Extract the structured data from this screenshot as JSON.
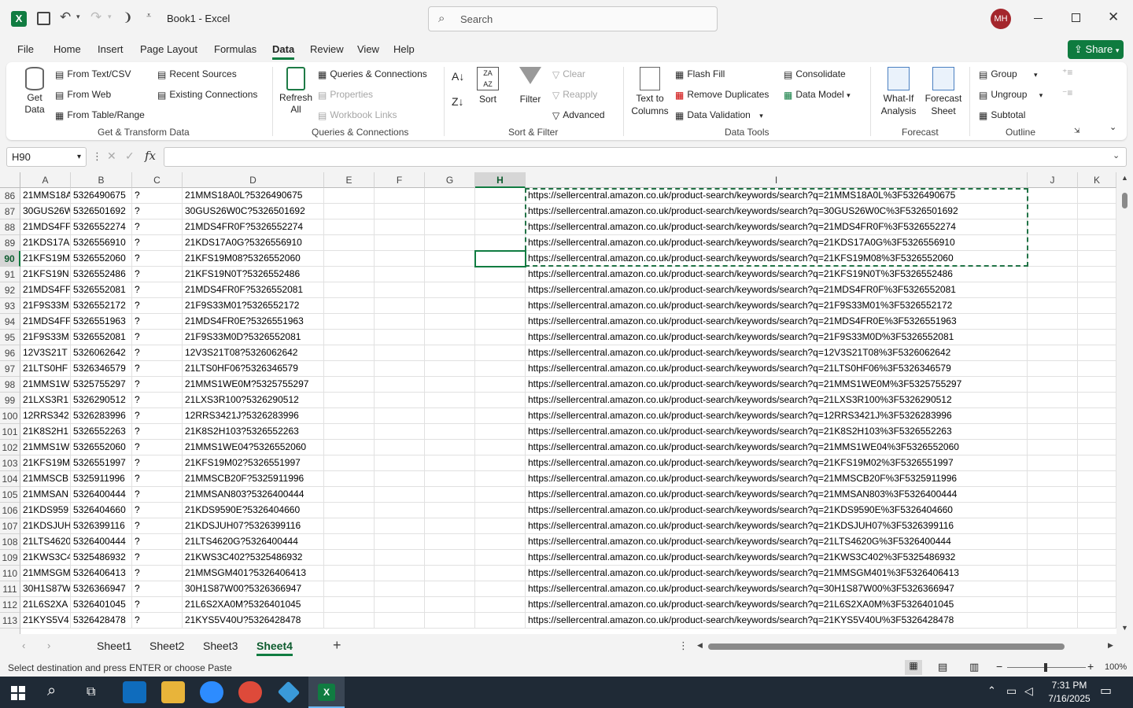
{
  "window": {
    "title": "Book1  -  Excel",
    "search_placeholder": "Search",
    "user_initials": "MH",
    "share_label": "Share"
  },
  "tabs": [
    "File",
    "Home",
    "Insert",
    "Page Layout",
    "Formulas",
    "Data",
    "Review",
    "View",
    "Help"
  ],
  "active_tab": "Data",
  "ribbon": {
    "get_data": "Get\nData",
    "from_text_csv": "From Text/CSV",
    "from_web": "From Web",
    "from_table_range": "From Table/Range",
    "recent_sources": "Recent Sources",
    "existing_connections": "Existing Connections",
    "group_get_transform": "Get & Transform Data",
    "refresh_all": "Refresh All",
    "queries_connections": "Queries & Connections",
    "properties": "Properties",
    "workbook_links": "Workbook Links",
    "group_queries": "Queries & Connections",
    "sort": "Sort",
    "filter": "Filter",
    "clear": "Clear",
    "reapply": "Reapply",
    "advanced": "Advanced",
    "group_sort_filter": "Sort & Filter",
    "text_to_columns": "Text to Columns",
    "flash_fill": "Flash Fill",
    "remove_duplicates": "Remove Duplicates",
    "data_validation": "Data Validation",
    "consolidate": "Consolidate",
    "data_model": "Data Model",
    "group_data_tools": "Data Tools",
    "what_if": "What-If Analysis",
    "forecast_sheet": "Forecast Sheet",
    "group_forecast": "Forecast",
    "group_btn": "Group",
    "ungroup": "Ungroup",
    "subtotal": "Subtotal",
    "group_outline": "Outline"
  },
  "namebox": "H90",
  "formula": "",
  "columns": [
    "A",
    "B",
    "C",
    "D",
    "E",
    "F",
    "G",
    "H",
    "I",
    "J",
    "K"
  ],
  "selected_column": "H",
  "selected_row": "90",
  "rows": [
    {
      "n": "86",
      "a": "21MMS18A",
      "b": "5326490675",
      "c": "?",
      "d": "21MMS18A0L?5326490675",
      "i": "https://sellercentral.amazon.co.uk/product-search/keywords/search?q=21MMS18A0L%3F5326490675"
    },
    {
      "n": "87",
      "a": "30GUS26W",
      "b": "5326501692",
      "c": "?",
      "d": "30GUS26W0C?5326501692",
      "i": "https://sellercentral.amazon.co.uk/product-search/keywords/search?q=30GUS26W0C%3F5326501692"
    },
    {
      "n": "88",
      "a": "21MDS4FF",
      "b": "5326552274",
      "c": "?",
      "d": "21MDS4FR0F?5326552274",
      "i": "https://sellercentral.amazon.co.uk/product-search/keywords/search?q=21MDS4FR0F%3F5326552274"
    },
    {
      "n": "89",
      "a": "21KDS17A",
      "b": "5326556910",
      "c": "?",
      "d": "21KDS17A0G?5326556910",
      "i": "https://sellercentral.amazon.co.uk/product-search/keywords/search?q=21KDS17A0G%3F5326556910"
    },
    {
      "n": "90",
      "a": "21KFS19M",
      "b": "5326552060",
      "c": "?",
      "d": "21KFS19M08?5326552060",
      "i": "https://sellercentral.amazon.co.uk/product-search/keywords/search?q=21KFS19M08%3F5326552060"
    },
    {
      "n": "91",
      "a": "21KFS19N",
      "b": "5326552486",
      "c": "?",
      "d": "21KFS19N0T?5326552486",
      "i": "https://sellercentral.amazon.co.uk/product-search/keywords/search?q=21KFS19N0T%3F5326552486"
    },
    {
      "n": "92",
      "a": "21MDS4FF",
      "b": "5326552081",
      "c": "?",
      "d": "21MDS4FR0F?5326552081",
      "i": "https://sellercentral.amazon.co.uk/product-search/keywords/search?q=21MDS4FR0F%3F5326552081"
    },
    {
      "n": "93",
      "a": "21F9S33M",
      "b": "5326552172",
      "c": "?",
      "d": "21F9S33M01?5326552172",
      "i": "https://sellercentral.amazon.co.uk/product-search/keywords/search?q=21F9S33M01%3F5326552172"
    },
    {
      "n": "94",
      "a": "21MDS4FF",
      "b": "5326551963",
      "c": "?",
      "d": "21MDS4FR0E?5326551963",
      "i": "https://sellercentral.amazon.co.uk/product-search/keywords/search?q=21MDS4FR0E%3F5326551963"
    },
    {
      "n": "95",
      "a": "21F9S33M",
      "b": "5326552081",
      "c": "?",
      "d": "21F9S33M0D?5326552081",
      "i": "https://sellercentral.amazon.co.uk/product-search/keywords/search?q=21F9S33M0D%3F5326552081"
    },
    {
      "n": "96",
      "a": "12V3S21T",
      "b": "5326062642",
      "c": "?",
      "d": "12V3S21T08?5326062642",
      "i": "https://sellercentral.amazon.co.uk/product-search/keywords/search?q=12V3S21T08%3F5326062642"
    },
    {
      "n": "97",
      "a": "21LTS0HF",
      "b": "5326346579",
      "c": "?",
      "d": "21LTS0HF06?5326346579",
      "i": "https://sellercentral.amazon.co.uk/product-search/keywords/search?q=21LTS0HF06%3F5326346579"
    },
    {
      "n": "98",
      "a": "21MMS1W",
      "b": "5325755297",
      "c": "?",
      "d": "21MMS1WE0M?5325755297",
      "i": "https://sellercentral.amazon.co.uk/product-search/keywords/search?q=21MMS1WE0M%3F5325755297"
    },
    {
      "n": "99",
      "a": "21LXS3R1",
      "b": "5326290512",
      "c": "?",
      "d": "21LXS3R100?5326290512",
      "i": "https://sellercentral.amazon.co.uk/product-search/keywords/search?q=21LXS3R100%3F5326290512"
    },
    {
      "n": "100",
      "a": "12RRS342",
      "b": "5326283996",
      "c": "?",
      "d": "12RRS3421J?5326283996",
      "i": "https://sellercentral.amazon.co.uk/product-search/keywords/search?q=12RRS3421J%3F5326283996"
    },
    {
      "n": "101",
      "a": "21K8S2H1",
      "b": "5326552263",
      "c": "?",
      "d": "21K8S2H103?5326552263",
      "i": "https://sellercentral.amazon.co.uk/product-search/keywords/search?q=21K8S2H103%3F5326552263"
    },
    {
      "n": "102",
      "a": "21MMS1W",
      "b": "5326552060",
      "c": "?",
      "d": "21MMS1WE04?5326552060",
      "i": "https://sellercentral.amazon.co.uk/product-search/keywords/search?q=21MMS1WE04%3F5326552060"
    },
    {
      "n": "103",
      "a": "21KFS19M",
      "b": "5326551997",
      "c": "?",
      "d": "21KFS19M02?5326551997",
      "i": "https://sellercentral.amazon.co.uk/product-search/keywords/search?q=21KFS19M02%3F5326551997"
    },
    {
      "n": "104",
      "a": "21MMSCB",
      "b": "5325911996",
      "c": "?",
      "d": "21MMSCB20F?5325911996",
      "i": "https://sellercentral.amazon.co.uk/product-search/keywords/search?q=21MMSCB20F%3F5325911996"
    },
    {
      "n": "105",
      "a": "21MMSAN",
      "b": "5326400444",
      "c": "?",
      "d": "21MMSAN803?5326400444",
      "i": "https://sellercentral.amazon.co.uk/product-search/keywords/search?q=21MMSAN803%3F5326400444"
    },
    {
      "n": "106",
      "a": "21KDS959",
      "b": "5326404660",
      "c": "?",
      "d": "21KDS9590E?5326404660",
      "i": "https://sellercentral.amazon.co.uk/product-search/keywords/search?q=21KDS9590E%3F5326404660"
    },
    {
      "n": "107",
      "a": "21KDSJUH",
      "b": "5326399116",
      "c": "?",
      "d": "21KDSJUH07?5326399116",
      "i": "https://sellercentral.amazon.co.uk/product-search/keywords/search?q=21KDSJUH07%3F5326399116"
    },
    {
      "n": "108",
      "a": "21LTS4620",
      "b": "5326400444",
      "c": "?",
      "d": "21LTS4620G?5326400444",
      "i": "https://sellercentral.amazon.co.uk/product-search/keywords/search?q=21LTS4620G%3F5326400444"
    },
    {
      "n": "109",
      "a": "21KWS3C4",
      "b": "5325486932",
      "c": "?",
      "d": "21KWS3C402?5325486932",
      "i": "https://sellercentral.amazon.co.uk/product-search/keywords/search?q=21KWS3C402%3F5325486932"
    },
    {
      "n": "110",
      "a": "21MMSGM",
      "b": "5326406413",
      "c": "?",
      "d": "21MMSGM401?5326406413",
      "i": "https://sellercentral.amazon.co.uk/product-search/keywords/search?q=21MMSGM401%3F5326406413"
    },
    {
      "n": "111",
      "a": "30H1S87W",
      "b": "5326366947",
      "c": "?",
      "d": "30H1S87W00?5326366947",
      "i": "https://sellercentral.amazon.co.uk/product-search/keywords/search?q=30H1S87W00%3F5326366947"
    },
    {
      "n": "112",
      "a": "21L6S2XA",
      "b": "5326401045",
      "c": "?",
      "d": "21L6S2XA0M?5326401045",
      "i": "https://sellercentral.amazon.co.uk/product-search/keywords/search?q=21L6S2XA0M%3F5326401045"
    },
    {
      "n": "113",
      "a": "21KYS5V4",
      "b": "5326428478",
      "c": "?",
      "d": "21KYS5V40U?5326428478",
      "i": "https://sellercentral.amazon.co.uk/product-search/keywords/search?q=21KYS5V40U%3F5326428478"
    }
  ],
  "sheets": [
    "Sheet1",
    "Sheet2",
    "Sheet3",
    "Sheet4"
  ],
  "active_sheet": "Sheet4",
  "status": {
    "message": "Select destination and press ENTER or choose Paste",
    "zoom": "100%"
  },
  "taskbar": {
    "time": "7:31 PM",
    "date": "7/16/2025"
  },
  "colors": {
    "excel_green": "#107c41",
    "share_green": "#0f7b3f",
    "avatar": "#a4262c",
    "taskbar": "#1f2a36"
  }
}
